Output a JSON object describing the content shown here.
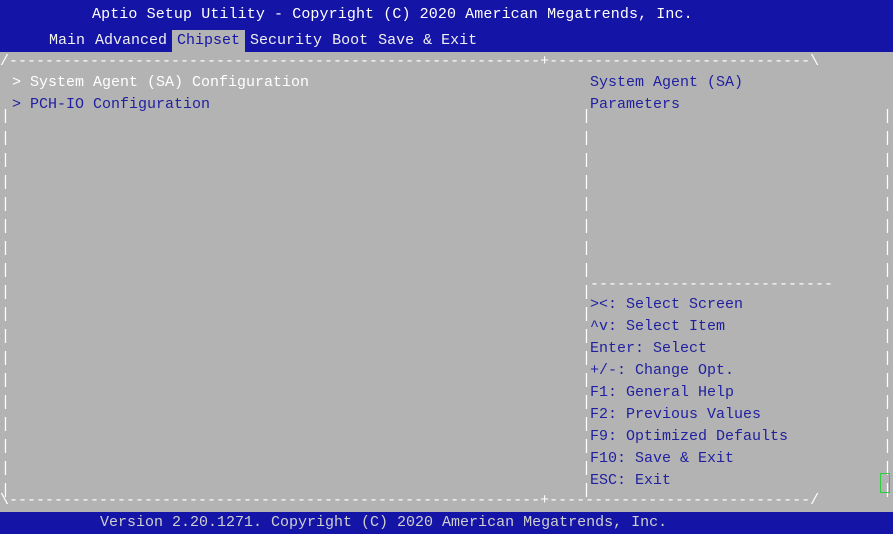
{
  "header": {
    "title": "Aptio Setup Utility - Copyright (C) 2020 American Megatrends, Inc."
  },
  "tabs": [
    {
      "label": "Main",
      "active": false
    },
    {
      "label": "Advanced",
      "active": false
    },
    {
      "label": "Chipset",
      "active": true
    },
    {
      "label": "Security",
      "active": false
    },
    {
      "label": "Boot",
      "active": false
    },
    {
      "label": "Save & Exit",
      "active": false
    }
  ],
  "menu": {
    "items": [
      {
        "label": "> System Agent (SA) Configuration",
        "selected": true
      },
      {
        "label": "> PCH-IO Configuration",
        "selected": false
      }
    ]
  },
  "help": {
    "lines": [
      "System Agent (SA)",
      "Parameters"
    ]
  },
  "keys": {
    "lines": [
      "><: Select Screen",
      "^v: Select Item",
      "Enter: Select",
      "+/-: Change Opt.",
      "F1: General Help",
      "F2: Previous Values",
      "F9: Optimized Defaults",
      "F10: Save & Exit",
      "ESC: Exit"
    ]
  },
  "footer": {
    "version": "Version 2.20.1271. Copyright (C) 2020 American Megatrends, Inc."
  },
  "colors": {
    "bar": "#1414a6",
    "background": "#b3b3b3",
    "text": "#1f1fa0",
    "highlight": "#ffffff"
  }
}
